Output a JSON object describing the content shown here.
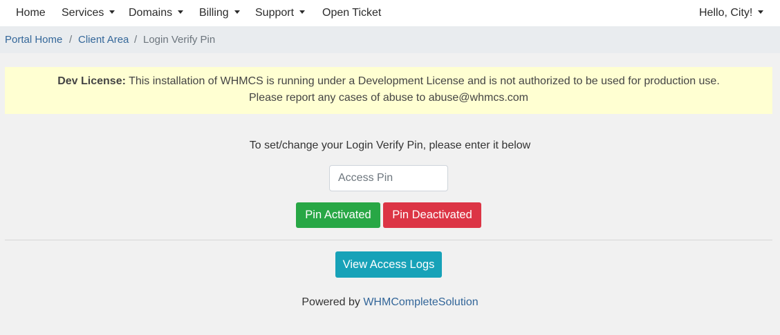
{
  "nav": {
    "home": "Home",
    "services": "Services",
    "domains": "Domains",
    "billing": "Billing",
    "support": "Support",
    "open_ticket": "Open Ticket",
    "user_greeting": "Hello, City!"
  },
  "breadcrumb": {
    "items": [
      "Portal Home",
      "Client Area",
      "Login Verify Pin"
    ],
    "separator": "/"
  },
  "alert": {
    "label": "Dev License:",
    "message": "This installation of WHMCS is running under a Development License and is not authorized to be used for production use.",
    "report_line": "Please report any cases of abuse to abuse@whmcs.com"
  },
  "main": {
    "instruction": "To set/change your Login Verify Pin, please enter it below",
    "pin_input": {
      "placeholder": "Access Pin",
      "value": ""
    },
    "activate_button": "Pin Activated",
    "deactivate_button": "Pin Deactivated",
    "view_logs_button": "View Access Logs"
  },
  "footer": {
    "prefix": "Powered by",
    "link_text": "WHMCompleteSolution"
  },
  "colors": {
    "success": "#28a745",
    "danger": "#dc3545",
    "info": "#17a2b8",
    "link": "#336699",
    "alert_bg": "#ffffd2"
  }
}
